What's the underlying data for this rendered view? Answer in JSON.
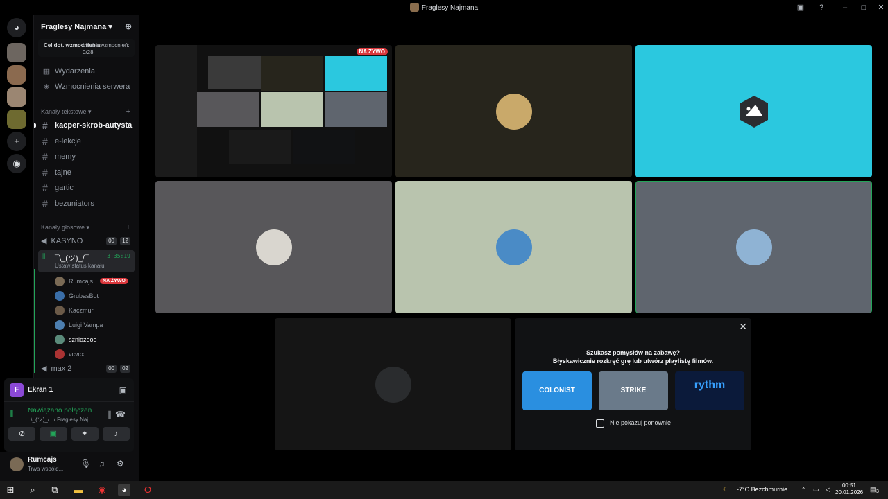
{
  "window": {
    "title": "Fraglesy Najmana"
  },
  "server": {
    "name": "Fraglesy Najmana",
    "boost_goal_label": "Cel dot. wzmocnienia",
    "boost_count_label": "Liczba wzmocnień: 0/28",
    "nav": [
      {
        "label": "Wydarzenia",
        "icon": "calendar-icon"
      },
      {
        "label": "Wzmocnienia serwera",
        "icon": "boost-icon"
      }
    ]
  },
  "text_category": "Kanały tekstowe",
  "text_channels": [
    "kacper-skrob-autysta",
    "e-lekcje",
    "memy",
    "tajne",
    "gartic",
    "bezuniators"
  ],
  "voice_category": "Kanały głosowe",
  "voice_channels": [
    {
      "name": "KASYNO",
      "pill_a": "00",
      "pill_b": "12"
    },
    {
      "name": "max 2",
      "pill_a": "00",
      "pill_b": "02"
    }
  ],
  "active_voice": {
    "name": "¯\\_(ツ)_/¯",
    "status": "Ustaw status kanału",
    "timer": "3:35:19"
  },
  "members": [
    {
      "name": "Rumcajs",
      "live": "NA ŻYWO",
      "color": "#7a6a55"
    },
    {
      "name": "GrubasBot",
      "live": "",
      "color": "#3a6ea8"
    },
    {
      "name": "Kaczmur",
      "live": "",
      "color": "#6b5a48"
    },
    {
      "name": "Luigi Vampa",
      "live": "",
      "color": "#4d7fb0"
    },
    {
      "name": "szniozooo",
      "live": "",
      "color": "#5a8a7a"
    },
    {
      "name": "vcvcx",
      "live": "",
      "color": "#a33"
    }
  ],
  "stream_panel": {
    "icon_letter": "F",
    "name": "Ekran 1",
    "connected": "Nawiązano połączen",
    "connected_sub": "¯\\_(ツ)_/¯ / Fraglesy Naj..."
  },
  "user": {
    "name": "Rumcajs",
    "status": "Trwa współd..."
  },
  "tiles": {
    "live_badge": "NA ŻYWO",
    "colors": [
      "#111111",
      "#27251c",
      "#2bc8df",
      "#58575a",
      "#b9c4ae",
      "#5f656e",
      "#151515"
    ]
  },
  "promo": {
    "line1": "Szukasz pomysłów na zabawę?",
    "line2": "Błyskawicznie rozkręć grę lub utwórz playlistę filmów.",
    "cards": [
      "COLONIST",
      "STRIKE",
      "rythm"
    ],
    "checkbox_label": "Nie pokazuj ponownie"
  },
  "taskbar": {
    "weather": "-7°C  Bezchmurnie",
    "time": "00:51",
    "date": "20.01.2026",
    "notifications": "3"
  }
}
